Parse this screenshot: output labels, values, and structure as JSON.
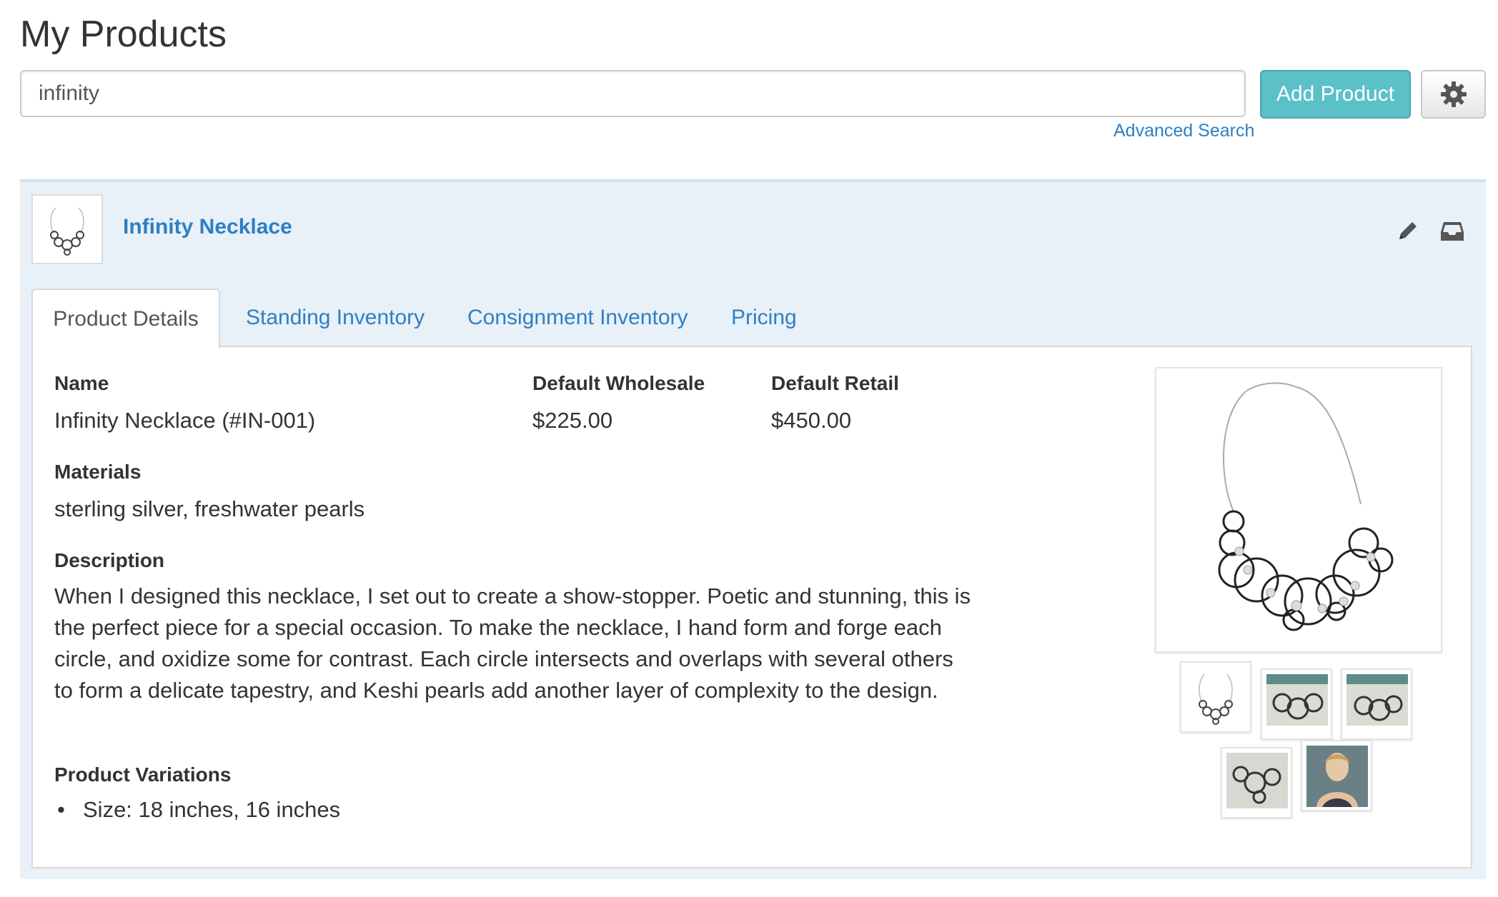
{
  "page": {
    "title": "My Products"
  },
  "search": {
    "value": "infinity",
    "advanced_link": "Advanced Search"
  },
  "toolbar": {
    "add_label": "Add Product"
  },
  "product": {
    "name": "Infinity Necklace",
    "tabs": [
      {
        "label": "Product Details",
        "active": true
      },
      {
        "label": "Standing Inventory",
        "active": false
      },
      {
        "label": "Consignment Inventory",
        "active": false
      },
      {
        "label": "Pricing",
        "active": false
      }
    ],
    "details": {
      "name_label": "Name",
      "name_value": "Infinity Necklace (#IN-001)",
      "wholesale_label": "Default Wholesale",
      "wholesale_value": "$225.00",
      "retail_label": "Default Retail",
      "retail_value": "$450.00",
      "materials_label": "Materials",
      "materials_value": "sterling silver, freshwater pearls",
      "description_label": "Description",
      "description_value": "When I designed this necklace, I set out to create a show-stopper. Poetic and stunning, this is the perfect piece for a special occasion. To make the necklace, I hand form and forge each circle, and oxidize some for contrast. Each circle intersects and overlaps with several others to form a delicate tapestry, and Keshi pearls add another layer of complexity to the design.",
      "variations_label": "Product Variations",
      "variations": [
        "Size: 18 inches, 16 inches"
      ]
    }
  },
  "icons": {
    "gear": "gear-icon",
    "edit": "pencil-icon",
    "archive": "archive-tray-icon"
  },
  "colors": {
    "accent": "#5bc0c8",
    "link": "#2f7fc2",
    "panel_bg": "#e8f0f8"
  }
}
